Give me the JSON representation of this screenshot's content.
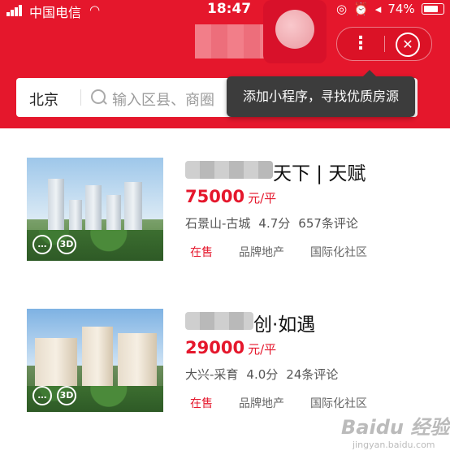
{
  "status_bar": {
    "carrier": "中国电信",
    "time": "18:47",
    "battery": "74%"
  },
  "search": {
    "city": "北京",
    "placeholder": "输入区县、商圈"
  },
  "tooltip": {
    "text": "添加小程序，寻找优质房源"
  },
  "listings": [
    {
      "name_visible": "天下 | 天赋",
      "price": "75000",
      "price_unit": "元/平",
      "district": "石景山-古城",
      "rating": "4.7分",
      "reviews": "657条评论",
      "tags": [
        "在售",
        "品牌地产",
        "国际化社区"
      ]
    },
    {
      "name_visible": "创·如遇",
      "price": "29000",
      "price_unit": "元/平",
      "district": "大兴-采育",
      "rating": "4.0分",
      "reviews": "24条评论",
      "tags": [
        "在售",
        "品牌地产",
        "国际化社区"
      ]
    }
  ],
  "watermark": {
    "brand": "Baidu 经验",
    "url": "jingyan.baidu.com"
  },
  "colors": {
    "brand_red": "#e5172c",
    "tooltip_bg": "#3c3c3c"
  }
}
